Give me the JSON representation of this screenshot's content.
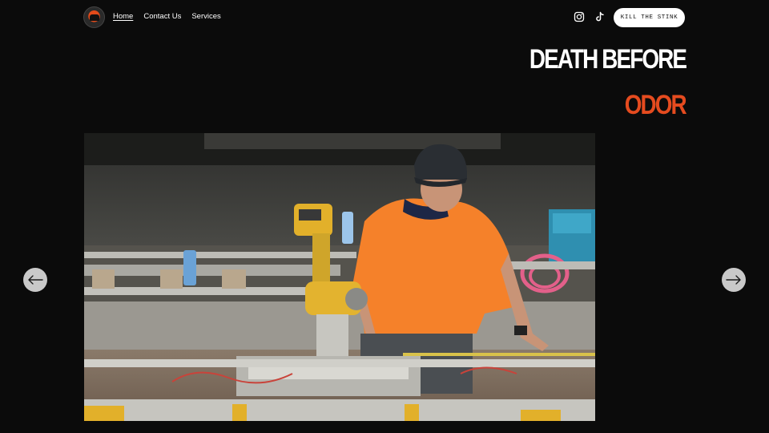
{
  "nav": {
    "items": [
      {
        "label": "Home",
        "active": true
      },
      {
        "label": "Contact Us",
        "active": false
      },
      {
        "label": "Services",
        "active": false
      }
    ]
  },
  "header": {
    "social_icons": [
      "instagram-icon",
      "tiktok-icon"
    ],
    "cta_label": "KILL THE STINK"
  },
  "hero": {
    "line1": "DEATH BEFORE",
    "line2": "ODOR"
  },
  "colors": {
    "background": "#0b0b0b",
    "accent": "#e54b1f",
    "cta_background": "#ffffff"
  },
  "carousel": {
    "prev_icon": "arrow-left-icon",
    "next_icon": "arrow-right-icon"
  }
}
